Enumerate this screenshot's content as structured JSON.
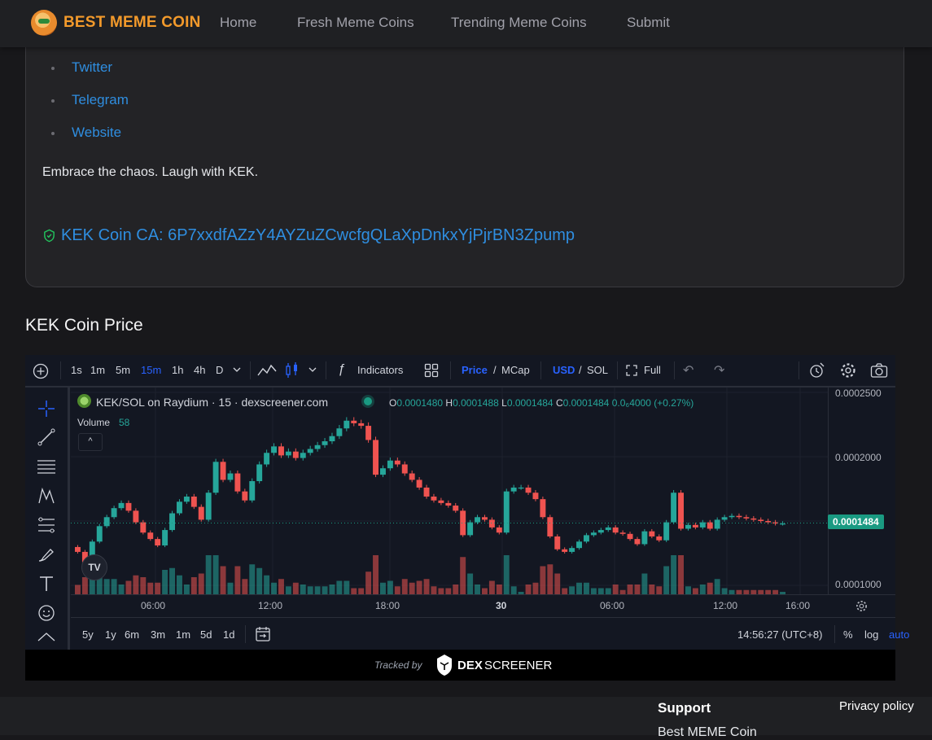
{
  "nav": {
    "brand": "BEST MEME COIN",
    "links": [
      "Home",
      "Fresh Meme Coins",
      "Trending Meme Coins",
      "Submit"
    ]
  },
  "card": {
    "links": [
      "Twitter",
      "Telegram",
      "Website"
    ],
    "tagline": "Embrace the chaos. Laugh with KEK.",
    "ca_label": "KEK Coin CA: 6P7xxdfAZzY4AYZuZCwcfgQLaXpDnkxYjPjrBN3Zpump"
  },
  "section_title": "KEK Coin Price",
  "chart": {
    "timeframes": [
      "1s",
      "1m",
      "5m",
      "15m",
      "1h",
      "4h",
      "D"
    ],
    "active_timeframe": "15m",
    "indicators_label": "Indicators",
    "price_label": "Price",
    "mcap_label": "MCap",
    "usd_label": "USD",
    "sol_label": "SOL",
    "full_label": "Full",
    "pair_title": "KEK/SOL on Raydium · 15 · dexscreener.com",
    "ohlc": {
      "o_label": "O",
      "o": "0.0001480",
      "h_label": "H",
      "h": "0.0001488",
      "l_label": "L",
      "l": "0.0001484",
      "c_label": "C",
      "c": "0.0001484",
      "change": "0.0₆4000 (+0.27%)"
    },
    "volume_label": "Volume",
    "volume_value": "58",
    "price_ticks": [
      "0.0002500",
      "0.0002000",
      "0.0001000"
    ],
    "current_price": "0.0001484",
    "time_ticks": [
      "06:00",
      "12:00",
      "18:00",
      "30",
      "06:00",
      "12:00",
      "16:00"
    ],
    "ranges": [
      "5y",
      "1y",
      "6m",
      "3m",
      "1m",
      "5d",
      "1d"
    ],
    "clock": "14:56:27 (UTC+8)",
    "pct_label": "%",
    "log_label": "log",
    "auto_label": "auto",
    "tracked_by": "Tracked by",
    "dex_brand_a": "DEX",
    "dex_brand_b": "SCREENER",
    "colors": {
      "up": "#26a69a",
      "down": "#ef5350",
      "accent": "#2962ff",
      "price_tag": "#1a9a82"
    }
  },
  "chart_data": {
    "type": "candlestick",
    "ylim": [
      0.0001,
      0.00025
    ],
    "closes": [
      0.000126,
      0.000118,
      0.000134,
      0.000146,
      0.000153,
      0.00016,
      0.000164,
      0.000158,
      0.000149,
      0.000141,
      0.000136,
      0.000131,
      0.000143,
      0.000156,
      0.000165,
      0.000169,
      0.000161,
      0.000151,
      0.000172,
      0.000196,
      0.000182,
      0.000187,
      0.000173,
      0.000166,
      0.000181,
      0.000194,
      0.000203,
      0.000208,
      0.000201,
      0.000204,
      0.000199,
      0.000203,
      0.000206,
      0.000209,
      0.000212,
      0.000216,
      0.000222,
      0.000228,
      0.000226,
      0.000224,
      0.000213,
      0.000186,
      0.000191,
      0.000197,
      0.000194,
      0.000187,
      0.000182,
      0.000176,
      0.000169,
      0.000166,
      0.000164,
      0.000162,
      0.000158,
      0.000139,
      0.000149,
      0.000153,
      0.000151,
      0.000145,
      0.000141,
      0.000173,
      0.000176,
      0.000176,
      0.000172,
      0.000167,
      0.000153,
      0.000138,
      0.000128,
      0.000126,
      0.000129,
      0.000134,
      0.000139,
      0.000141,
      0.000143,
      0.000145,
      0.000141,
      0.00014,
      0.000136,
      0.000132,
      0.000142,
      0.000138,
      0.000135,
      0.000149,
      0.000172,
      0.000144,
      0.000147,
      0.000145,
      0.000149,
      0.000144,
      0.000151,
      0.000153,
      0.000154,
      0.000153,
      0.000152,
      0.000151,
      0.00015,
      0.000149,
      0.000148,
      0.000148
    ]
  }
}
